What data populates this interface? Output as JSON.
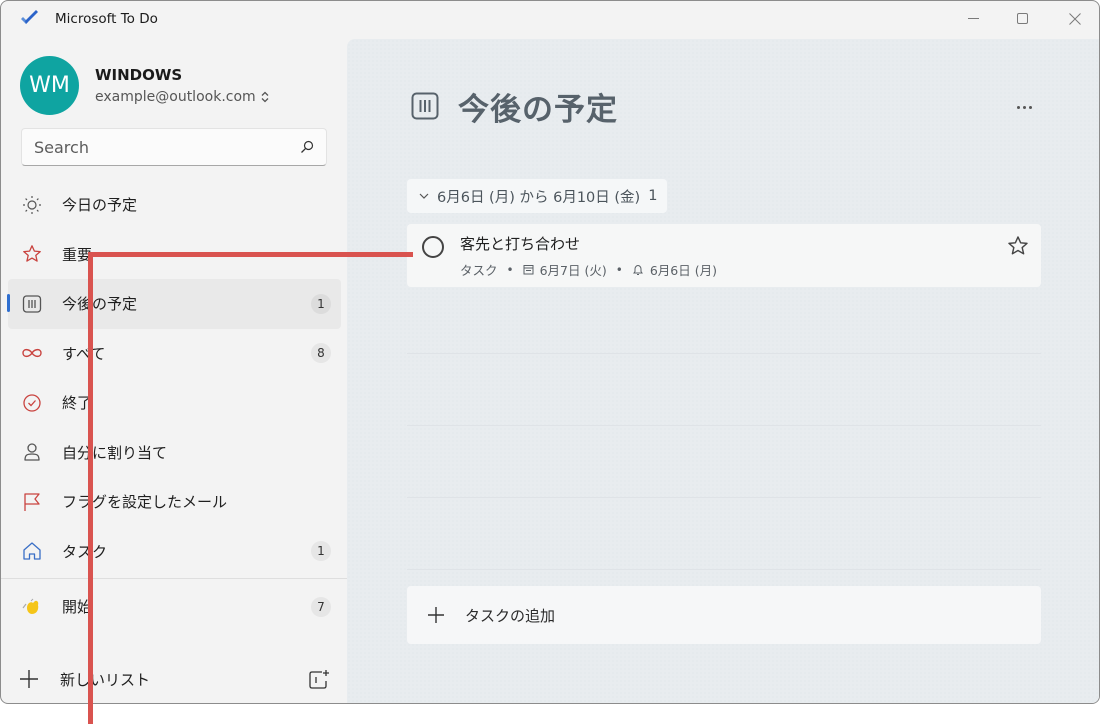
{
  "window": {
    "title": "Microsoft To Do",
    "controls": {
      "minimize": "minimize",
      "maximize": "maximize",
      "close": "close"
    }
  },
  "account": {
    "initials": "WM",
    "name": "WINDOWS",
    "email": "example@outlook.com",
    "avatar_color": "#0fa4a1"
  },
  "search": {
    "placeholder": "Search",
    "value": ""
  },
  "sidebar": {
    "items": [
      {
        "label": "今日の予定",
        "icon": "sun-icon",
        "count": null,
        "active": false
      },
      {
        "label": "重要",
        "icon": "star-icon",
        "count": null,
        "active": false
      },
      {
        "label": "今後の予定",
        "icon": "calendar-grid-icon",
        "count": "1",
        "active": true
      },
      {
        "label": "すべて",
        "icon": "infinity-icon",
        "count": "8",
        "active": false
      },
      {
        "label": "終了",
        "icon": "check-circle-icon",
        "count": null,
        "active": false
      },
      {
        "label": "自分に割り当て",
        "icon": "person-icon",
        "count": null,
        "active": false
      },
      {
        "label": "フラグを設定したメール",
        "icon": "flag-icon",
        "count": null,
        "active": false
      },
      {
        "label": "タスク",
        "icon": "home-icon",
        "count": "1",
        "active": false
      }
    ],
    "lists": [
      {
        "label": "開始",
        "icon": "waving-hand-icon",
        "count": "7"
      }
    ],
    "new_list_label": "新しいリスト",
    "accent_color": "#2f6fd0"
  },
  "main": {
    "title": "今後の予定",
    "group": {
      "label": "6月6日 (月) から 6月10日 (金)",
      "count": "1"
    },
    "tasks": [
      {
        "title": "客先と打ち合わせ",
        "list": "タスク",
        "due": "6月7日 (火)",
        "reminder": "6月6日 (月)",
        "important": false,
        "completed": false
      }
    ],
    "add_task_label": "タスクの追加"
  },
  "annotation": {
    "color": "#d9534f"
  }
}
